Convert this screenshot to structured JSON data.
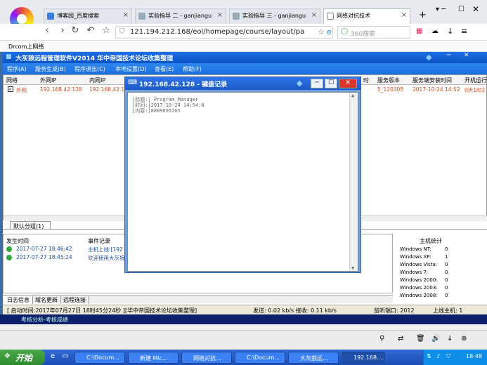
{
  "browser": {
    "tabs": [
      {
        "label": "博客园_百度搜索"
      },
      {
        "label": "实验指导 二 - ganjiangu"
      },
      {
        "label": "实验指导 三 - ganjiangu"
      },
      {
        "label": "网络对抗技术"
      }
    ],
    "new_tab": "+",
    "url": "121.194.212.168/eol/homepage/course/layout/pa",
    "search_placeholder": "360搜索",
    "bookmark": "Drcom上网络"
  },
  "app": {
    "title": "大灰狼远程管理软件V2014   华中帝国技术论坛收集整理",
    "menu": [
      "程序(A)",
      "服务生成(B)",
      "程序退出(C)",
      "本地设置(D)",
      "查看(E)",
      "帮助(F)"
    ],
    "grid": {
      "headers": [
        "网络",
        "外网IP",
        "内网IP",
        "时",
        "服务版本",
        "服务端安装时间",
        "开机运行"
      ],
      "row": {
        "net": "外网",
        "wan": "192.168.42.128",
        "lan": "192.168.42.1",
        "ver": "5_120305",
        "install": "2017-10-24 14:52",
        "boot": "0天1时2"
      }
    },
    "group_tab": "默认分组(1)",
    "log": {
      "headers": [
        "发生时间",
        "事件记录"
      ],
      "rows": [
        {
          "time": "2017-07-27 18:46:42",
          "event": "主机上线:[192"
        },
        {
          "time": "2017-07-27 18:45:24",
          "event": "欢迎使用大灰狼"
        }
      ]
    },
    "stats": {
      "title": "主机统计",
      "items": [
        {
          "label": "Windows NT:",
          "value": "0"
        },
        {
          "label": "Windows XP:",
          "value": "1"
        },
        {
          "label": "Windows Vista:",
          "value": "0"
        },
        {
          "label": "Windows 7:",
          "value": "0"
        },
        {
          "label": "Windows 2000:",
          "value": "0"
        },
        {
          "label": "Windows 2003:",
          "value": "0"
        },
        {
          "label": "Windows 2008:",
          "value": "0"
        }
      ]
    },
    "log_tabs": [
      "日志信息",
      "域名更新",
      "远程连接"
    ],
    "status": {
      "start": "[ 启动时间:2017年07月27日 18时45分24秒 ][华中帝国技术论坛收集整理]",
      "traffic": "发送: 0.02 kb/s 接收: 0.11 kb/s",
      "port": "监听端口: 2012",
      "online": "上线主机: 1"
    }
  },
  "dialog": {
    "title": "192.168.42.128 - 键盘记录",
    "lines": [
      "[标题:] Program Manager",
      "[时间:]2017-10-24  14:54:8",
      "[内容:]8889895265"
    ]
  },
  "darkbar": "考核分析-考核成绩",
  "taskbar": {
    "start": "开始",
    "tasks": [
      "C:\\Docum...",
      "新建 Mic...",
      "网络对抗...",
      "C:\\Docum...",
      "大灰狼远...",
      "192.168...."
    ],
    "time": "18:48"
  }
}
